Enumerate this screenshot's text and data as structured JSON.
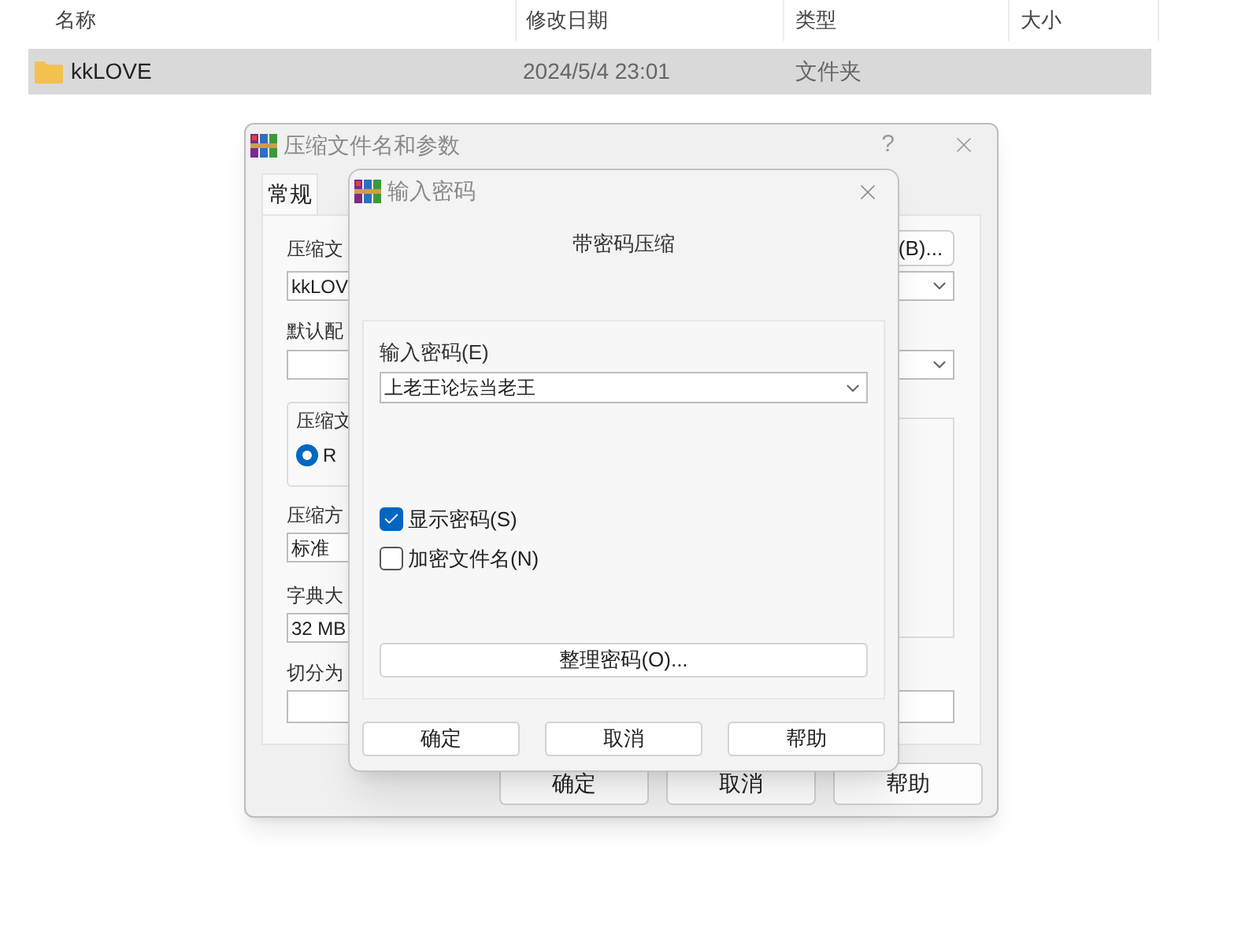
{
  "explorer": {
    "columns": [
      "名称",
      "修改日期",
      "类型",
      "大小"
    ],
    "rows": [
      {
        "name": "kkLOVE",
        "modified": "2024/5/4 23:01",
        "type": "文件夹",
        "selected": true
      }
    ]
  },
  "archive_dialog": {
    "title": "压缩文件名和参数",
    "help": "?",
    "tabs": [
      {
        "label": "常规",
        "selected": true
      }
    ],
    "archive_name_label": "压缩文",
    "browse_button": "(B)...",
    "archive_name": "kkLOV",
    "profile_label": "默认配",
    "format_group_label": "压缩文",
    "format_options": [
      {
        "label": "R",
        "selected": true
      }
    ],
    "method_label": "压缩方",
    "method": "标准",
    "dictionary_label": "字典大",
    "dictionary": "32 MB",
    "split_label": "切分为",
    "buttons": [
      "确定",
      "取消",
      "帮助"
    ]
  },
  "password_dialog": {
    "title": "输入密码",
    "heading": "带密码压缩",
    "password_label": "输入密码(E)",
    "password": "上老王论坛当老王",
    "options": [
      {
        "label": "显示密码(S)",
        "checked": true
      },
      {
        "label": "加密文件名(N)",
        "checked": false
      }
    ],
    "organize_button": "整理密码(O)...",
    "buttons": [
      "确定",
      "取消",
      "帮助"
    ]
  }
}
